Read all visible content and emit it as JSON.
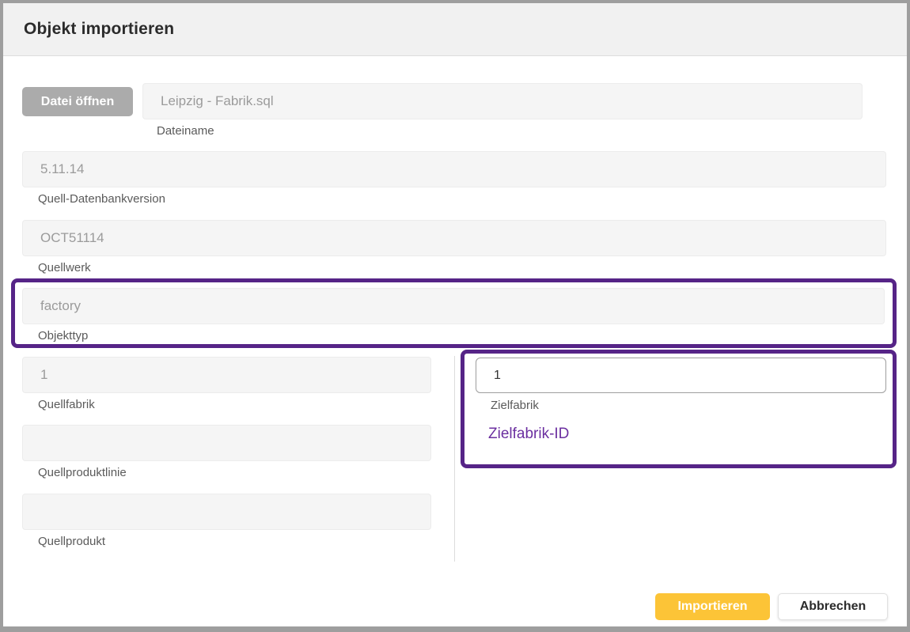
{
  "window": {
    "title": "Objekt importieren"
  },
  "form": {
    "open_file_button": "Datei öffnen",
    "fields": {
      "dateiname": {
        "value": "Leipzig - Fabrik.sql",
        "label": "Dateiname"
      },
      "quell_datenbankversion": {
        "value": "5.11.14",
        "label": "Quell-Datenbankversion"
      },
      "quellwerk": {
        "value": "OCT51114",
        "label": "Quellwerk"
      },
      "objekttyp": {
        "value": "factory",
        "label": "Objekttyp"
      },
      "quellfabrik": {
        "value": "1",
        "label": "Quellfabrik"
      },
      "quellproduktlinie": {
        "value": "",
        "label": "Quellproduktlinie"
      },
      "quellprodukt": {
        "value": "",
        "label": "Quellprodukt"
      },
      "zielfabrik": {
        "value": "1",
        "label": "Zielfabrik"
      }
    },
    "annotations": {
      "zielfabrik_id_note": "Zielfabrik-ID"
    }
  },
  "footer": {
    "import_button": "Importieren",
    "cancel_button": "Abbrechen"
  },
  "colors": {
    "annotation_purple": "#562487",
    "note_purple": "#6b2fa0",
    "primary_yellow": "#fcc437",
    "frame_gray": "#9e9e9e",
    "field_gray": "#f5f5f5"
  }
}
